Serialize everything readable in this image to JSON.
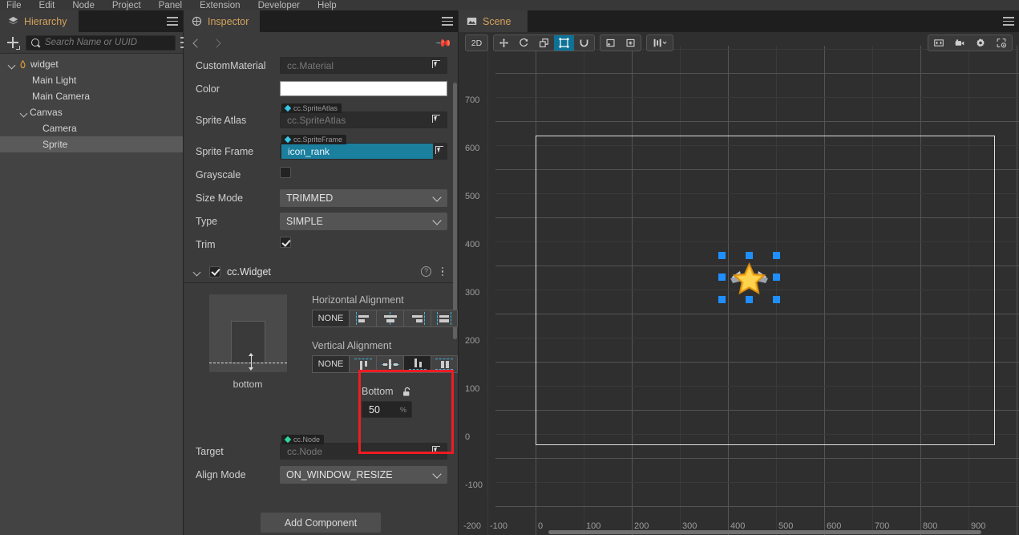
{
  "menubar": {
    "items": [
      "File",
      "Edit",
      "Node",
      "Project",
      "Panel",
      "Extension",
      "Developer",
      "Help"
    ]
  },
  "hierarchy": {
    "tab_label": "Hierarchy",
    "tab_icon": "layers-icon",
    "add_icon": "add-node-icon",
    "search": {
      "placeholder": "Search Name or UUID",
      "value": ""
    },
    "options_icon": "list-options-icon",
    "menu_icon": "hamburger-icon",
    "nodes": [
      {
        "label": "widget",
        "depth": 0,
        "expandable": true,
        "icon": "prefab-flame-icon",
        "selected": false
      },
      {
        "label": "Main Light",
        "depth": 1,
        "expandable": false,
        "icon": "",
        "selected": false
      },
      {
        "label": "Main Camera",
        "depth": 1,
        "expandable": false,
        "icon": "",
        "selected": false
      },
      {
        "label": "Canvas",
        "depth": 1,
        "expandable": true,
        "icon": "",
        "selected": false
      },
      {
        "label": "Camera",
        "depth": 2,
        "expandable": false,
        "icon": "",
        "selected": false
      },
      {
        "label": "Sprite",
        "depth": 2,
        "expandable": false,
        "icon": "",
        "selected": true
      }
    ]
  },
  "inspector": {
    "tab_label": "Inspector",
    "tab_icon": "inspector-icon",
    "menu_icon": "hamburger-icon",
    "nav": {
      "back_icon": "chevron-left-icon",
      "forward_icon": "chevron-right-icon",
      "pin_icon": "pin-icon"
    },
    "sprite": {
      "custom_material": {
        "label": "CustomMaterial",
        "value": "cc.Material",
        "picker_icon": "node-picker-icon"
      },
      "color": {
        "label": "Color",
        "value": "#FFFFFF"
      },
      "sprite_atlas": {
        "label": "Sprite Atlas",
        "type_tag": "cc.SpriteAtlas",
        "value": "cc.SpriteAtlas",
        "picker_icon": "node-picker-icon"
      },
      "sprite_frame": {
        "label": "Sprite Frame",
        "type_tag": "cc.SpriteFrame",
        "value": "icon_rank",
        "selected": true,
        "picker_icon": "node-picker-icon"
      },
      "grayscale": {
        "label": "Grayscale",
        "checked": false
      },
      "size_mode": {
        "label": "Size Mode",
        "value": "TRIMMED"
      },
      "type": {
        "label": "Type",
        "value": "SIMPLE"
      },
      "trim": {
        "label": "Trim",
        "checked": true
      }
    },
    "widget": {
      "title": "cc.Widget",
      "enabled": true,
      "expanded": true,
      "help_icon": "help-circle-icon",
      "more_icon": "kebab-menu-icon",
      "preview_caption": "bottom",
      "horizontal": {
        "title": "Horizontal Alignment",
        "none_label": "NONE",
        "buttons": [
          "align-left-icon",
          "align-center-h-icon",
          "align-right-icon",
          "align-stretch-h-icon"
        ],
        "active_index": -1
      },
      "vertical": {
        "title": "Vertical Alignment",
        "none_label": "NONE",
        "buttons": [
          "align-top-icon",
          "align-middle-v-icon",
          "align-bottom-icon",
          "align-stretch-v-icon"
        ],
        "active_index": 2
      },
      "bottom": {
        "label": "Bottom",
        "value": "50",
        "unit": "%",
        "lock_icon": "unlock-icon"
      },
      "target": {
        "label": "Target",
        "type_tag": "cc.Node",
        "value": "cc.Node",
        "picker_icon": "node-picker-icon"
      },
      "align_mode": {
        "label": "Align Mode",
        "value": "ON_WINDOW_RESIZE"
      }
    },
    "add_component_label": "Add Component"
  },
  "scene": {
    "tab_label": "Scene",
    "tab_icon": "scene-icon",
    "menu_icon": "hamburger-icon",
    "toolbar": {
      "mode_label": "2D",
      "transform_tools": [
        "move-tool-icon",
        "rotate-tool-icon",
        "scale-tool-icon",
        "rect-tool-icon",
        "magnet-tool-icon"
      ],
      "active_tool_index": 3,
      "pivot_tools": [
        "pivot-icon",
        "coordinate-icon"
      ],
      "layout_tools": [
        "align-distribute-icon"
      ],
      "right_tools": [
        "gizmo-size-icon",
        "camera-icon",
        "settings-gear-icon",
        "scene-effects-icon"
      ]
    },
    "grid": {
      "x_labels": [
        "-200",
        "-100",
        "0",
        "100",
        "200",
        "300",
        "400",
        "500",
        "600",
        "700",
        "800",
        "900"
      ],
      "y_labels": [
        "700",
        "600",
        "500",
        "400",
        "300",
        "200",
        "100",
        "0",
        "-100"
      ]
    },
    "selected_node": {
      "name": "Sprite",
      "icon": "star-wings-icon"
    }
  }
}
